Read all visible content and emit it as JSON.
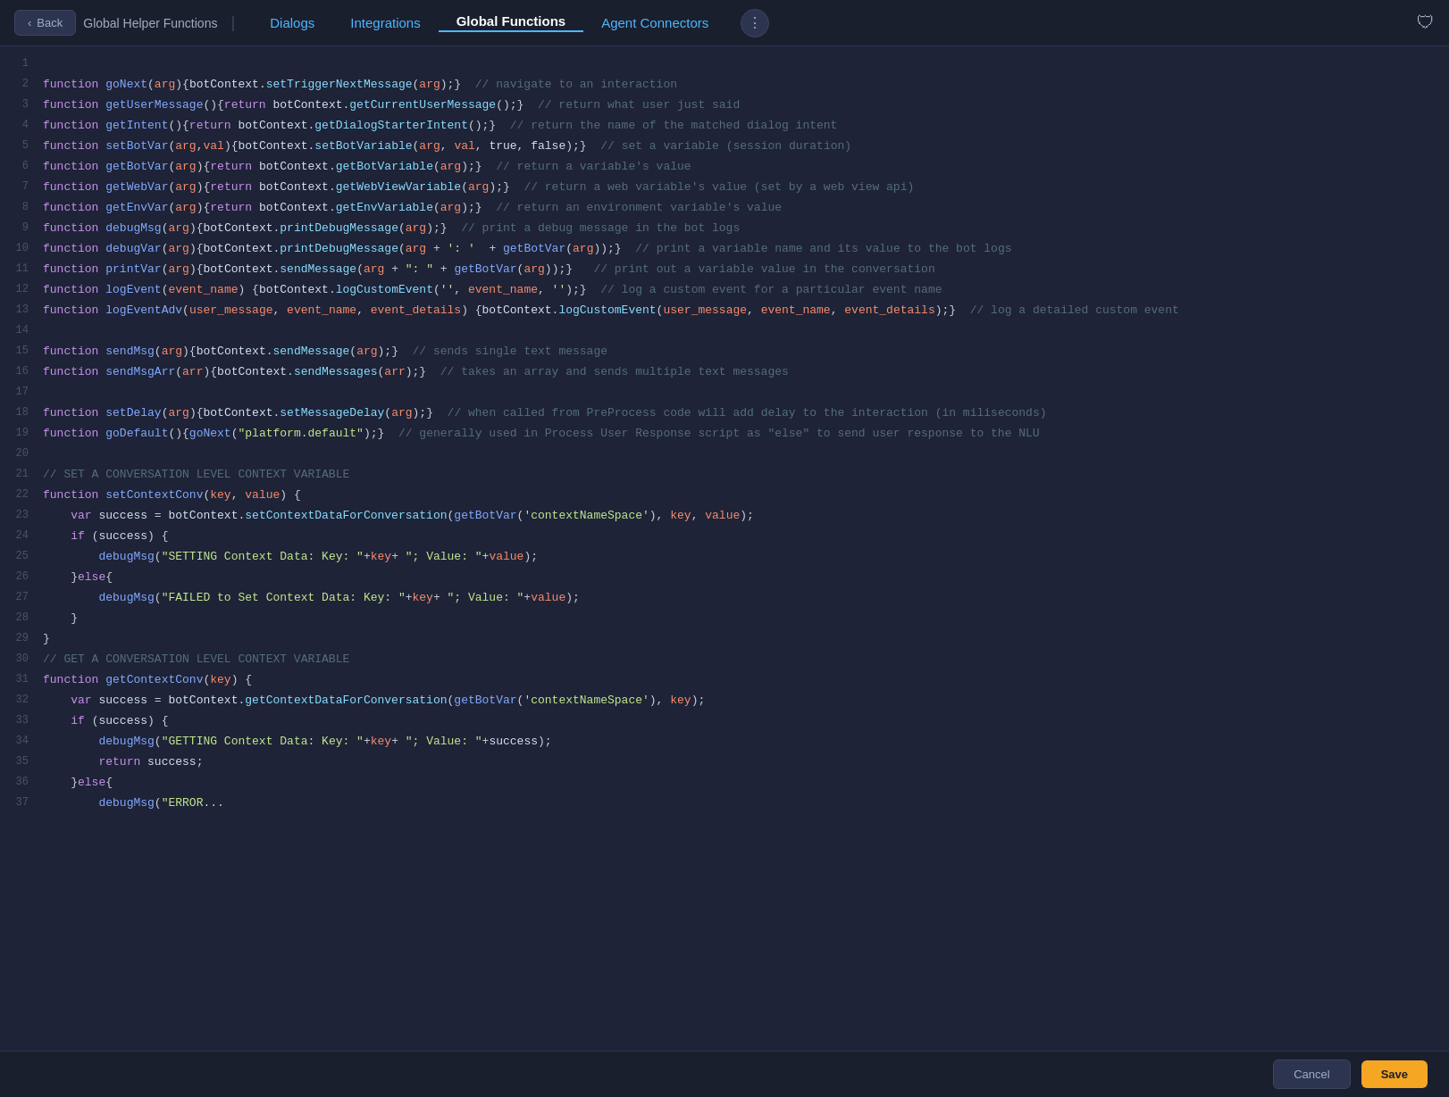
{
  "header": {
    "back_label": "Back",
    "title": "Global Helper Functions",
    "divider": "|",
    "nav_items": [
      {
        "id": "dialogs",
        "label": "Dialogs",
        "active": false
      },
      {
        "id": "integrations",
        "label": "Integrations",
        "active": false
      },
      {
        "id": "global-functions",
        "label": "Global Functions",
        "active": true
      },
      {
        "id": "agent-connectors",
        "label": "Agent Connectors",
        "active": false
      }
    ],
    "more_icon": "⋮",
    "shield_icon": "🛡"
  },
  "footer": {
    "cancel_label": "Cancel",
    "save_label": "Save"
  },
  "code_lines": [
    {
      "num": 1,
      "content": ""
    },
    {
      "num": 2,
      "content": "function goNext(arg){botContext.setTriggerNextMessage(arg);}  // navigate to an interaction"
    },
    {
      "num": 3,
      "content": "function getUserMessage(){return botContext.getCurrentUserMessage();}  // return what user just said"
    },
    {
      "num": 4,
      "content": "function getIntent(){return botContext.getDialogStarterIntent();}  // return the name of the matched dialog intent"
    },
    {
      "num": 5,
      "content": "function setBotVar(arg,val){botContext.setBotVariable(arg, val, true, false);}  // set a variable (session duration)"
    },
    {
      "num": 6,
      "content": "function getBotVar(arg){return botContext.getBotVariable(arg);}  // return a variable's value"
    },
    {
      "num": 7,
      "content": "function getWebVar(arg){return botContext.getWebViewVariable(arg);}  // return a web variable's value (set by a web view api)"
    },
    {
      "num": 8,
      "content": "function getEnvVar(arg){return botContext.getEnvVariable(arg);}  // return an environment variable's value"
    },
    {
      "num": 9,
      "content": "function debugMsg(arg){botContext.printDebugMessage(arg);}  // print a debug message in the bot logs"
    },
    {
      "num": 10,
      "content": "function debugVar(arg){botContext.printDebugMessage(arg + ': ' + getBotVar(arg));}  // print a variable name and its value to the bot logs"
    },
    {
      "num": 11,
      "content": "function printVar(arg){botContext.sendMessage(arg + \": \" + getBotVar(arg));}   // print out a variable value in the conversation"
    },
    {
      "num": 12,
      "content": "function logEvent(event_name) {botContext.logCustomEvent('', event_name, '');}  // log a custom event for a particular event name"
    },
    {
      "num": 13,
      "content": "function logEventAdv(user_message, event_name, event_details) {botContext.logCustomEvent(user_message, event_name, event_details);}  // log a detailed custom event"
    },
    {
      "num": 14,
      "content": ""
    },
    {
      "num": 15,
      "content": "function sendMsg(arg){botContext.sendMessage(arg);}  // sends single text message"
    },
    {
      "num": 16,
      "content": "function sendMsgArr(arr){botContext.sendMessages(arr);}  // takes an array and sends multiple text messages"
    },
    {
      "num": 17,
      "content": ""
    },
    {
      "num": 18,
      "content": "function setDelay(arg){botContext.setMessageDelay(arg);}  // when called from PreProcess code will add delay to the interaction (in miliseconds)"
    },
    {
      "num": 19,
      "content": "function goDefault(){goNext(\"platform.default\");}  // generally used in Process User Response script as \"else\" to send user response to the NLU"
    },
    {
      "num": 20,
      "content": ""
    },
    {
      "num": 21,
      "content": "// SET A CONVERSATION LEVEL CONTEXT VARIABLE"
    },
    {
      "num": 22,
      "content": "function setContextConv(key, value) {"
    },
    {
      "num": 23,
      "content": "    var success = botContext.setContextDataForConversation(getBotVar('contextNameSpace'), key, value);"
    },
    {
      "num": 24,
      "content": "    if (success) {"
    },
    {
      "num": 25,
      "content": "        debugMsg(\"SETTING Context Data: Key: \"+key+ \"; Value: \"+value);"
    },
    {
      "num": 26,
      "content": "    }else{"
    },
    {
      "num": 27,
      "content": "        debugMsg(\"FAILED to Set Context Data: Key: \"+key+ \"; Value: \"+value);"
    },
    {
      "num": 28,
      "content": "    }"
    },
    {
      "num": 29,
      "content": "}"
    },
    {
      "num": 30,
      "content": "// GET A CONVERSATION LEVEL CONTEXT VARIABLE"
    },
    {
      "num": 31,
      "content": "function getContextConv(key) {"
    },
    {
      "num": 32,
      "content": "    var success = botContext.getContextDataForConversation(getBotVar('contextNameSpace'), key);"
    },
    {
      "num": 33,
      "content": "    if (success) {"
    },
    {
      "num": 34,
      "content": "        debugMsg(\"GETTING Context Data: Key: \"+key+ \"; Value: \"+success);"
    },
    {
      "num": 35,
      "content": "        return success;"
    },
    {
      "num": 36,
      "content": "    }else{"
    },
    {
      "num": 37,
      "content": "        debugMsg(\"ERROR..."
    }
  ]
}
